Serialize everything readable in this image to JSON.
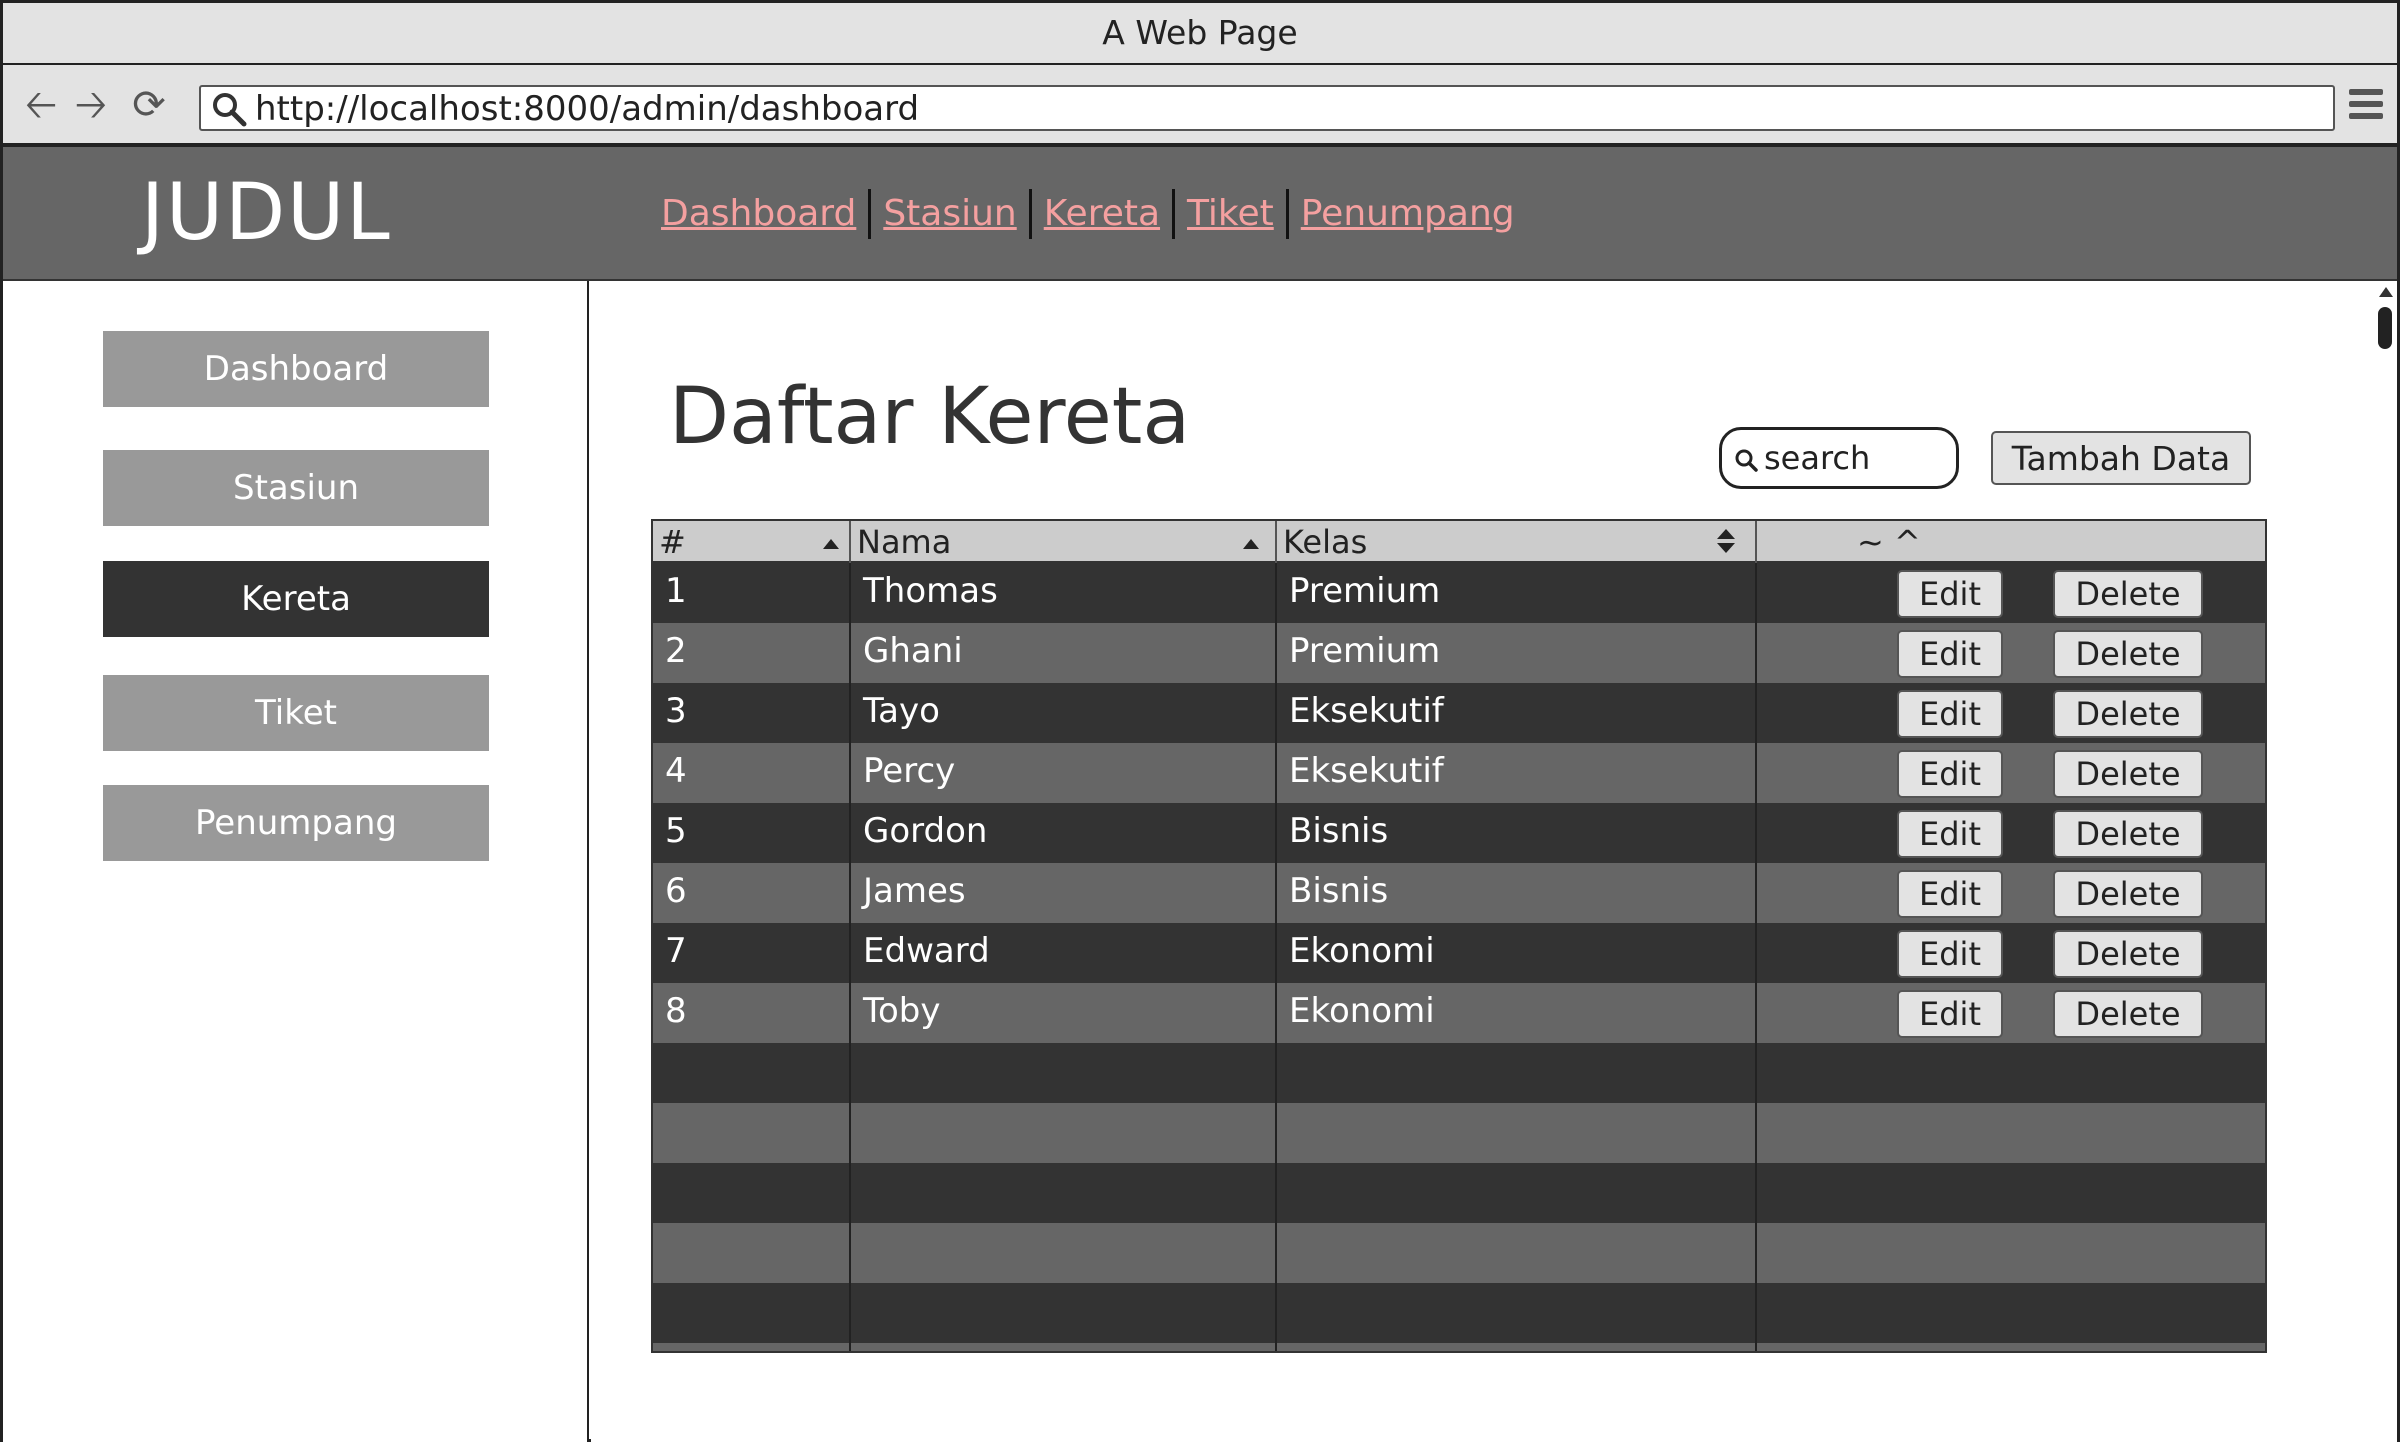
{
  "window": {
    "title": "A Web Page"
  },
  "browser": {
    "url": "http://localhost:8000/admin/dashboard"
  },
  "header": {
    "brand": "JUDUL",
    "nav": [
      "Dashboard",
      "Stasiun",
      "Kereta",
      "Tiket",
      "Penumpang"
    ]
  },
  "sidebar": {
    "items": [
      {
        "label": "Dashboard",
        "active": false
      },
      {
        "label": "Stasiun",
        "active": false
      },
      {
        "label": "Kereta",
        "active": true
      },
      {
        "label": "Tiket",
        "active": false
      },
      {
        "label": "Penumpang",
        "active": false
      }
    ]
  },
  "main": {
    "title": "Daftar Kereta",
    "search": {
      "placeholder": "search"
    },
    "add_label": "Tambah Data",
    "table": {
      "columns": [
        "#",
        "Nama",
        "Kelas",
        "~ ^"
      ],
      "rows": [
        {
          "no": "1",
          "nama": "Thomas",
          "kelas": "Premium"
        },
        {
          "no": "2",
          "nama": "Ghani",
          "kelas": "Premium"
        },
        {
          "no": "3",
          "nama": "Tayo",
          "kelas": "Eksekutif"
        },
        {
          "no": "4",
          "nama": "Percy",
          "kelas": "Eksekutif"
        },
        {
          "no": "5",
          "nama": "Gordon",
          "kelas": "Bisnis"
        },
        {
          "no": "6",
          "nama": "James",
          "kelas": "Bisnis"
        },
        {
          "no": "7",
          "nama": "Edward",
          "kelas": "Ekonomi"
        },
        {
          "no": "8",
          "nama": "Toby",
          "kelas": "Ekonomi"
        }
      ],
      "edit_label": "Edit",
      "delete_label": "Delete"
    }
  },
  "colors": {
    "header_bg": "#666666",
    "nav_link": "#f4a0a0",
    "sidebar_item": "#999999",
    "sidebar_active": "#333333",
    "row_dark": "#333333",
    "row_light": "#666666"
  }
}
